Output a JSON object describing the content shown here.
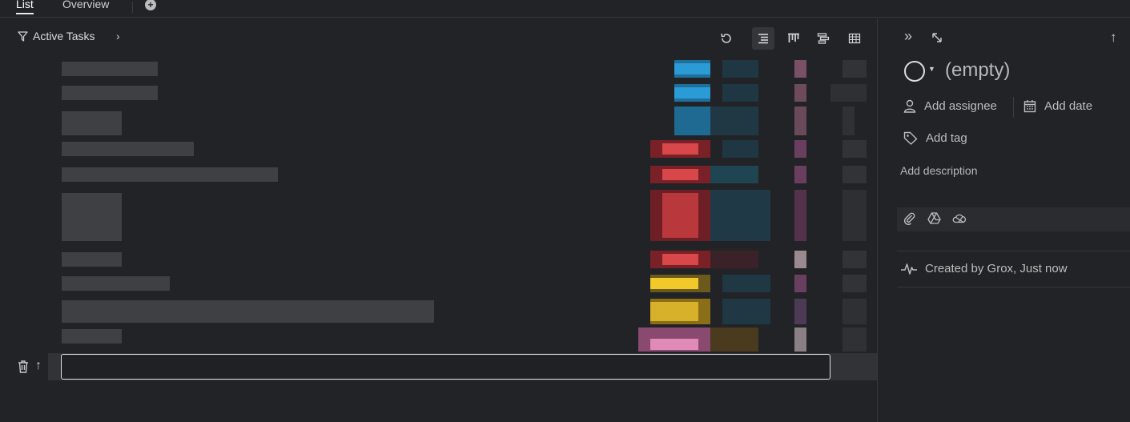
{
  "tabs": {
    "list": "List",
    "overview": "Overview",
    "add_icon": "plus-circle-icon"
  },
  "toolbar": {
    "filter_label": "Active Tasks",
    "icons": [
      "refresh-icon",
      "list-view-icon",
      "board-view-icon",
      "gantt-view-icon",
      "table-view-icon"
    ]
  },
  "new_task": {
    "value": "",
    "placeholder": ""
  },
  "detail": {
    "title": "(empty)",
    "add_assignee": "Add assignee",
    "add_date": "Add date",
    "add_tag": "Add tag",
    "add_description": "Add description",
    "attachment_icons": [
      "paperclip-icon",
      "google-drive-icon",
      "onedrive-icon"
    ],
    "activity": "Created by Grox, Just now"
  },
  "colors": {
    "background": "#222326",
    "accent_blue": "#2b9bd6",
    "accent_red": "#d8474a",
    "accent_yellow": "#f2c92a",
    "accent_pink": "#e08ab6"
  }
}
